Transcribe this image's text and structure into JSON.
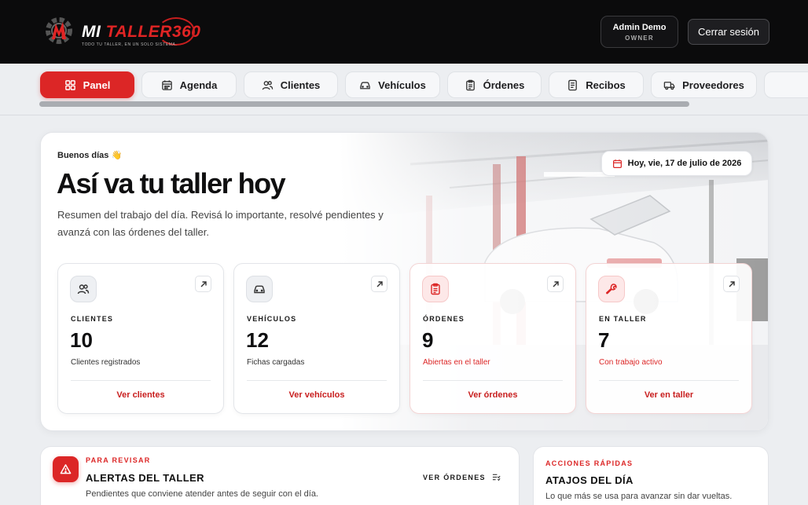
{
  "header": {
    "logo_text_white": "MI ",
    "logo_text_red": "TALLER",
    "logo_text_suffix": "360",
    "logo_tagline": "TODO TU TALLER, EN UN SOLO SISTEMA.",
    "user_name": "Admin Demo",
    "user_role": "OWNER",
    "logout_label": "Cerrar sesión"
  },
  "nav": {
    "tabs": [
      {
        "label": "Panel",
        "icon": "grid-icon"
      },
      {
        "label": "Agenda",
        "icon": "calendar-icon"
      },
      {
        "label": "Clientes",
        "icon": "users-icon"
      },
      {
        "label": "Vehículos",
        "icon": "car-icon"
      },
      {
        "label": "Órdenes",
        "icon": "clipboard-icon"
      },
      {
        "label": "Recibos",
        "icon": "receipt-icon"
      },
      {
        "label": "Proveedores",
        "icon": "truck-icon"
      }
    ],
    "active": "Panel"
  },
  "hero": {
    "greeting": "Buenos días 👋",
    "title": "Así va tu taller hoy",
    "subtitle": "Resumen del trabajo del día. Revisá lo importante, resolvé pendientes y avanzá con las órdenes del taller.",
    "date": "Hoy, vie, 17 de julio de 2026"
  },
  "stats": [
    {
      "label": "CLIENTES",
      "value": "10",
      "desc": "Clientes registrados",
      "link": "Ver clientes"
    },
    {
      "label": "VEHÍCULOS",
      "value": "12",
      "desc": "Fichas cargadas",
      "link": "Ver vehículos"
    },
    {
      "label": "ÓRDENES",
      "value": "9",
      "desc": "Abiertas en el taller",
      "link": "Ver órdenes"
    },
    {
      "label": "EN TALLER",
      "value": "7",
      "desc": "Con trabajo activo",
      "link": "Ver en taller"
    }
  ],
  "alerts": {
    "eyebrow": "PARA REVISAR",
    "title": "ALERTAS DEL TALLER",
    "desc": "Pendientes que conviene atender antes de seguir con el día.",
    "link": "VER ÓRDENES"
  },
  "quick": {
    "eyebrow": "ACCIONES RÁPIDAS",
    "title": "ATAJOS DEL DÍA",
    "desc": "Lo que más se usa para avanzar sin dar vueltas."
  },
  "colors": {
    "accent": "#dc2626",
    "header_bg": "#0b0b0c",
    "page_bg": "#eceef1"
  }
}
